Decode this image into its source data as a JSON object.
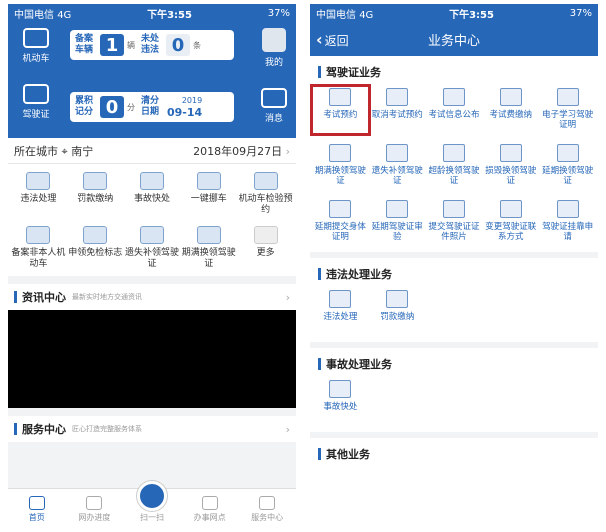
{
  "status": {
    "carrier": "中国电信",
    "net": "4G",
    "time": "下午3:55",
    "battery": "37%"
  },
  "home": {
    "tiles": {
      "vehicle": "机动车",
      "license": "驾驶证",
      "mine": "我的",
      "message": "消息"
    },
    "card1": {
      "label": "备案车辆",
      "count": "1",
      "unit": "辆",
      "label2": "未处违法",
      "count2": "0",
      "unit2": "条"
    },
    "card2": {
      "label": "累积记分",
      "count": "0",
      "unit": "分",
      "label2": "清分日期",
      "date_year": "2019",
      "date_md": "09-14"
    },
    "city": {
      "label": "所在城市",
      "name": "南宁",
      "date": "2018年09月27日"
    },
    "grid": [
      "违法处理",
      "罚款缴纳",
      "事故快处",
      "一键挪车",
      "机动车检验预约",
      "备案非本人机动车",
      "申领免检标志",
      "遗失补领驾驶证",
      "期满换领驾驶证",
      "更多"
    ],
    "news": {
      "title": "资讯中心",
      "sub": "最新实时地方交通资讯"
    },
    "service": {
      "title": "服务中心",
      "sub": "匠心打造完整服务体系"
    },
    "tabs": [
      "首页",
      "网办进度",
      "扫一扫",
      "办事网点",
      "服务中心"
    ]
  },
  "business": {
    "back": "返回",
    "title": "业务中心",
    "sections": [
      {
        "title": "驾驶证业务",
        "items": [
          "考试预约",
          "取消考试预约",
          "考试信息公布",
          "考试费缴纳",
          "电子学习驾驶证明",
          "期满换领驾驶证",
          "遗失补领驾驶证",
          "超龄换领驾驶证",
          "损毁换领驾驶证",
          "延期换领驾驶证",
          "延期提交身体证明",
          "延期驾驶证审验",
          "提交驾驶证证件照片",
          "变更驾驶证联系方式",
          "驾驶证挂靠申请"
        ]
      },
      {
        "title": "违法处理业务",
        "items": [
          "违法处理",
          "罚款缴纳"
        ]
      },
      {
        "title": "事故处理业务",
        "items": [
          "事故快处"
        ]
      },
      {
        "title": "其他业务",
        "items": []
      }
    ]
  },
  "colors": {
    "primary": "#2667b8",
    "highlight": "#c0272d"
  }
}
